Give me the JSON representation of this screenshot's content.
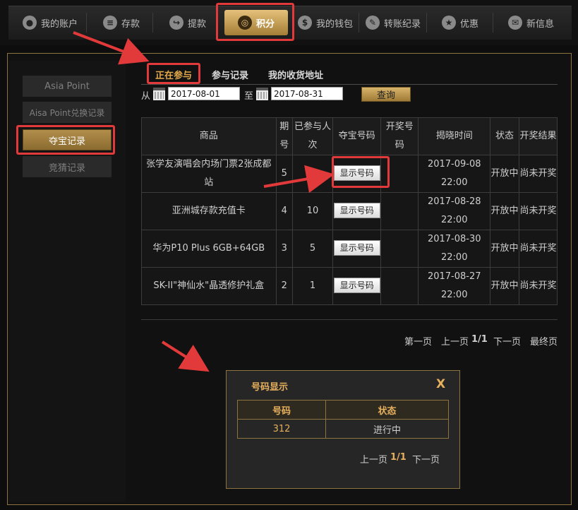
{
  "nav": {
    "items": [
      {
        "label": "我的账户",
        "icon": "user-icon"
      },
      {
        "label": "存款",
        "icon": "coins-icon"
      },
      {
        "label": "提款",
        "icon": "withdraw-icon"
      },
      {
        "label": "积分",
        "icon": "lifebuoy-icon"
      },
      {
        "label": "我的钱包",
        "icon": "dollar-icon"
      },
      {
        "label": "转账纪录",
        "icon": "pencil-icon"
      },
      {
        "label": "优惠",
        "icon": "star-icon"
      },
      {
        "label": "新信息",
        "icon": "mail-icon"
      }
    ],
    "active": "积分"
  },
  "sidebar": {
    "items": [
      {
        "label": "Asia Point"
      },
      {
        "label": "Aisa Point兑换记录"
      },
      {
        "label": "夺宝记录"
      },
      {
        "label": "竞猜记录"
      }
    ],
    "active": "夺宝记录"
  },
  "tabs": [
    {
      "label": "正在参与"
    },
    {
      "label": "参与记录"
    },
    {
      "label": "我的收货地址"
    }
  ],
  "filter": {
    "from_label": "从",
    "to_label": "至",
    "from_date": "2017-08-01",
    "to_date": "2017-08-31",
    "query_label": "查询"
  },
  "table": {
    "headers": [
      "商品",
      "期号",
      "已参与人次",
      "夺宝号码",
      "开奖号码",
      "揭晓时间",
      "状态",
      "开奖结果"
    ],
    "rows": [
      {
        "product": "张学友演唱会内场门票2张成都站",
        "period": "5",
        "count": "1",
        "button": "显示号码",
        "date": "2017-09-08",
        "time": "22:00",
        "status": "开放中",
        "result": "尚未开奖"
      },
      {
        "product": "亚洲城存款充值卡",
        "period": "4",
        "count": "10",
        "button": "显示号码",
        "date": "2017-08-28",
        "time": "22:00",
        "status": "开放中",
        "result": "尚未开奖"
      },
      {
        "product": "华为P10 Plus 6GB+64GB",
        "period": "3",
        "count": "5",
        "button": "显示号码",
        "date": "2017-08-30",
        "time": "22:00",
        "status": "开放中",
        "result": "尚未开奖"
      },
      {
        "product": "SK-II\"神仙水\"晶透修护礼盒",
        "period": "2",
        "count": "1",
        "button": "显示号码",
        "date": "2017-08-27",
        "time": "22:00",
        "status": "开放中",
        "result": "尚未开奖"
      }
    ]
  },
  "pager": {
    "first": "第一页",
    "prev": "上一页",
    "page": "1/1",
    "next": "下一页",
    "last": "最终页"
  },
  "popup": {
    "title": "号码显示",
    "close": "X",
    "headers": [
      "号码",
      "状态"
    ],
    "rows": [
      {
        "code": "312",
        "status": "进行中"
      }
    ],
    "prev": "上一页",
    "page": "1/1",
    "next": "下一页"
  },
  "colors": {
    "accent_gold": "#e6b05c",
    "highlight_red": "#e23a3a",
    "panel_border": "#8c7340"
  }
}
